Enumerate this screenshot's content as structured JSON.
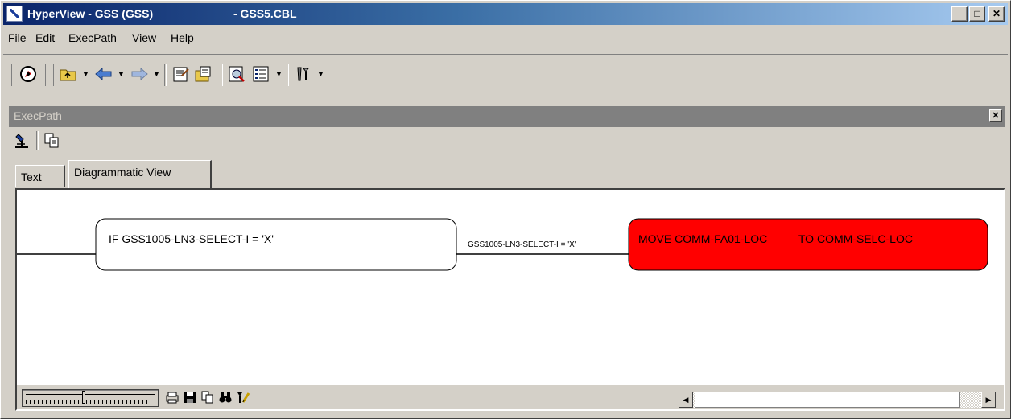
{
  "window": {
    "title": "HyperView - GSS (GSS)",
    "filename": "- GSS5.CBL",
    "minimize_label": "_",
    "maximize_label": "□",
    "close_label": "✕"
  },
  "menu": {
    "items": [
      {
        "label": "File"
      },
      {
        "label": "Edit"
      },
      {
        "label": "ExecPath"
      },
      {
        "label": "View"
      },
      {
        "label": "Help"
      }
    ]
  },
  "toolbar": {
    "icons": [
      "navigator-icon",
      "folder-up-icon",
      "back-arrow-icon",
      "forward-arrow-icon",
      "properties-icon",
      "edit-doc-icon",
      "find-icon",
      "list-view-icon",
      "tools-icon"
    ]
  },
  "panel": {
    "title": "ExecPath",
    "close_label": "✕"
  },
  "tabs": [
    {
      "label": "Text",
      "active": false
    },
    {
      "label": "Diagrammatic View",
      "active": true
    }
  ],
  "diagram": {
    "condition_node": "IF GSS1005-LN3-SELECT-I = 'X'",
    "edge_label": "GSS1005-LN3-SELECT-I = 'X'",
    "action_node": "MOVE COMM-FA01-LOC          TO COMM-SELC-LOC",
    "action_color": "#ff0000"
  },
  "bottombar": {
    "icons": [
      "print-icon",
      "save-icon",
      "copy-icon",
      "find-binoculars-icon",
      "edit-tools-icon"
    ],
    "scroll_left": "◀",
    "scroll_right": "▶"
  }
}
